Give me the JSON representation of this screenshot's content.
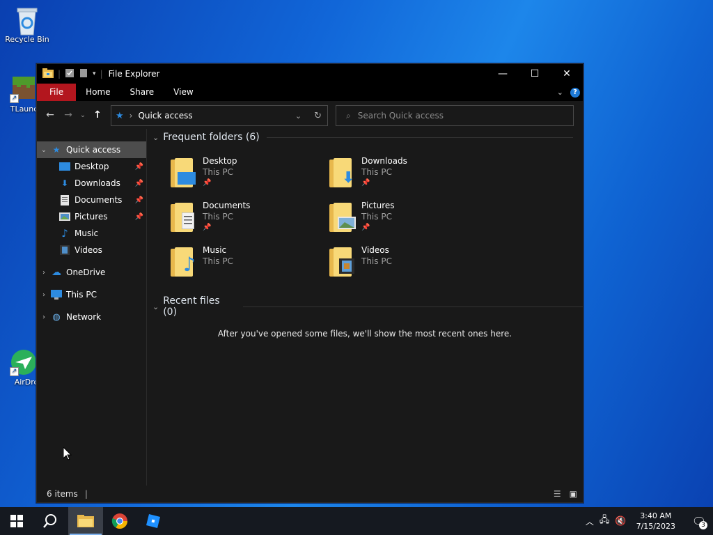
{
  "desktop": {
    "icons": [
      {
        "label": "Recycle Bin",
        "icon": "recycle-bin-icon"
      },
      {
        "label": "TLaunch",
        "icon": "minecraft-grass-block-icon"
      },
      {
        "label": "AirDro",
        "icon": "airdroid-icon"
      }
    ]
  },
  "window": {
    "title": "File Explorer",
    "controls": {
      "minimize": "—",
      "maximize": "☐",
      "close": "✕"
    },
    "ribbon": {
      "tabs": [
        "File",
        "Home",
        "Share",
        "View"
      ],
      "help": "?"
    },
    "address": {
      "path": "Quick access"
    },
    "search": {
      "placeholder": "Search Quick access"
    },
    "nav_pane": {
      "quick_access": "Quick access",
      "pinned": [
        {
          "label": "Desktop",
          "pinned": true
        },
        {
          "label": "Downloads",
          "pinned": true
        },
        {
          "label": "Documents",
          "pinned": true
        },
        {
          "label": "Pictures",
          "pinned": true
        },
        {
          "label": "Music",
          "pinned": false
        },
        {
          "label": "Videos",
          "pinned": false
        }
      ],
      "roots": [
        "OneDrive",
        "This PC",
        "Network"
      ]
    },
    "main": {
      "frequent_header": "Frequent folders (6)",
      "folders": [
        {
          "name": "Desktop",
          "location": "This PC",
          "pinned": true,
          "overlay": "desktop"
        },
        {
          "name": "Downloads",
          "location": "This PC",
          "pinned": true,
          "overlay": "downloads"
        },
        {
          "name": "Documents",
          "location": "This PC",
          "pinned": true,
          "overlay": "documents"
        },
        {
          "name": "Pictures",
          "location": "This PC",
          "pinned": true,
          "overlay": "pictures"
        },
        {
          "name": "Music",
          "location": "This PC",
          "pinned": false,
          "overlay": "music"
        },
        {
          "name": "Videos",
          "location": "This PC",
          "pinned": false,
          "overlay": "videos"
        }
      ],
      "recent_header": "Recent files (0)",
      "recent_empty": "After you've opened some files, we'll show the most recent ones here."
    },
    "status": {
      "items": "6 items"
    }
  },
  "taskbar": {
    "time": "3:40 AM",
    "date": "7/15/2023",
    "notifications": "3"
  },
  "colors": {
    "accent": "#1e7ad6",
    "file_tab": "#b3161e",
    "folder": "#f8d978"
  }
}
